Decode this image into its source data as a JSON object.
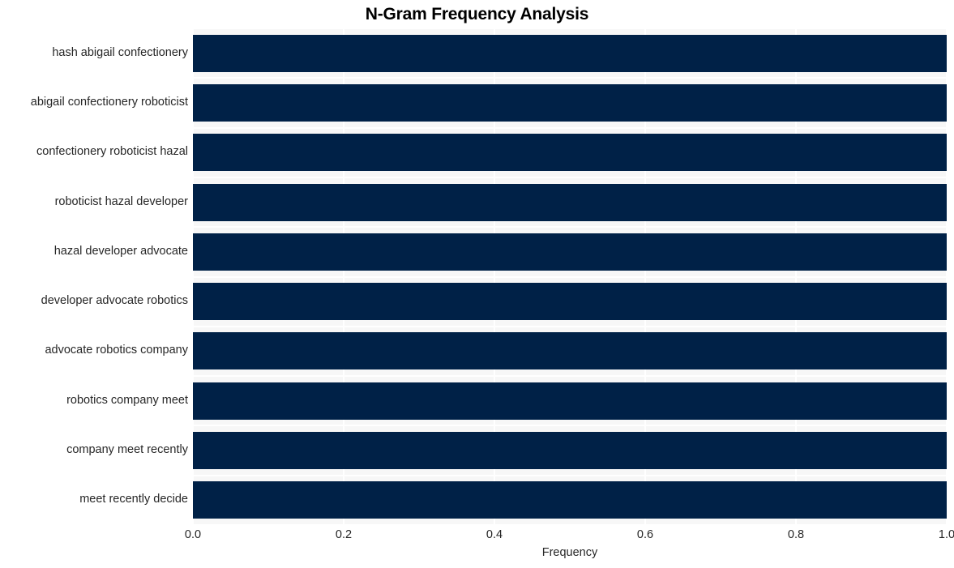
{
  "chart_data": {
    "type": "bar",
    "orientation": "horizontal",
    "title": "N-Gram Frequency Analysis",
    "xlabel": "Frequency",
    "ylabel": "",
    "xlim": [
      0.0,
      1.0
    ],
    "xticks": [
      "0.0",
      "0.2",
      "0.4",
      "0.6",
      "0.8",
      "1.0"
    ],
    "xtick_values": [
      0.0,
      0.2,
      0.4,
      0.6,
      0.8,
      1.0
    ],
    "grid": true,
    "legend": "none",
    "bar_color": "#002147",
    "plot_background": "#f7f7f7",
    "figure_background": "#ffffff",
    "categories": [
      "hash abigail confectionery",
      "abigail confectionery roboticist",
      "confectionery roboticist hazal",
      "roboticist hazal developer",
      "hazal developer advocate",
      "developer advocate robotics",
      "advocate robotics company",
      "robotics company meet",
      "company meet recently",
      "meet recently decide"
    ],
    "values": [
      1.0,
      1.0,
      1.0,
      1.0,
      1.0,
      1.0,
      1.0,
      1.0,
      1.0,
      1.0
    ]
  }
}
